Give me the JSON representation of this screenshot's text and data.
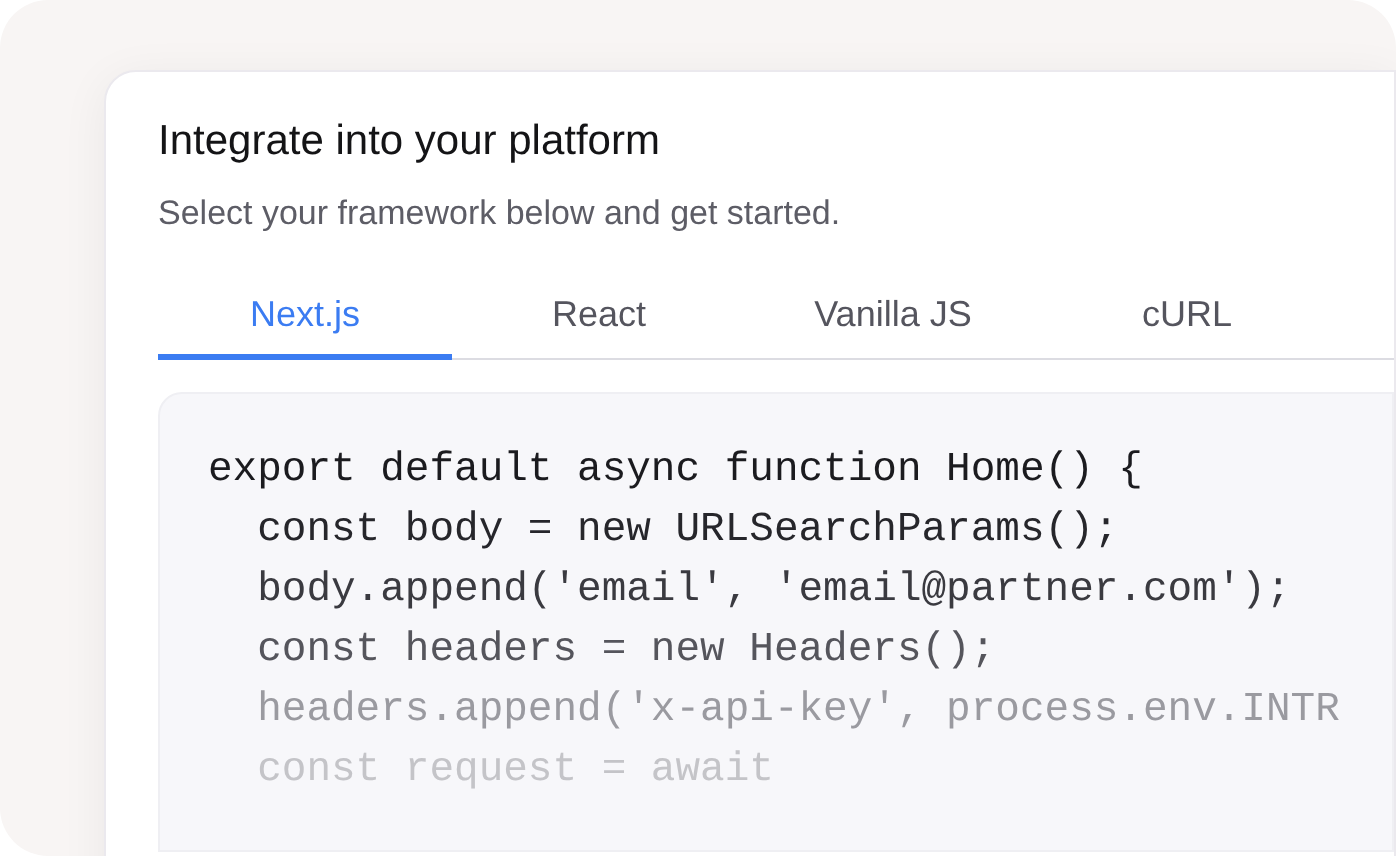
{
  "card": {
    "title": "Integrate into your platform",
    "subtitle": "Select your framework below and get started."
  },
  "tabs": [
    {
      "label": "Next.js",
      "selected": true
    },
    {
      "label": "React",
      "selected": false
    },
    {
      "label": "Vanilla JS",
      "selected": false
    },
    {
      "label": "cURL",
      "selected": false
    }
  ],
  "code_lines": [
    "export default async function Home() {",
    "  const body = new URLSearchParams();",
    "  body.append('email', 'email@partner.com');",
    "  const headers = new Headers();",
    "  headers.append('x-api-key', process.env.INTR",
    "  const request = await"
  ]
}
